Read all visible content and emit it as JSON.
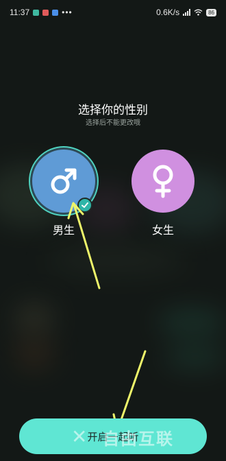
{
  "status_bar": {
    "time": "11:37",
    "net_speed": "0.6K/s",
    "battery": "86",
    "more": "•••",
    "app_icon_colors": [
      "#3fb8a0",
      "#e05a5a",
      "#4a8fe8"
    ]
  },
  "picker": {
    "title": "选择你的性别",
    "subtitle": "选择后不能更改哦",
    "options": [
      {
        "label": "男生",
        "icon": "male-symbol-icon",
        "color": "#5f9bd6",
        "selected": true
      },
      {
        "label": "女生",
        "icon": "female-symbol-icon",
        "color": "#d090e0",
        "selected": false
      }
    ]
  },
  "start_button": {
    "label": "开启一起听",
    "color": "#5fe6d3"
  },
  "watermark": {
    "text": "自由互联",
    "mark": "✕"
  },
  "annotation_color": "#eef56a"
}
